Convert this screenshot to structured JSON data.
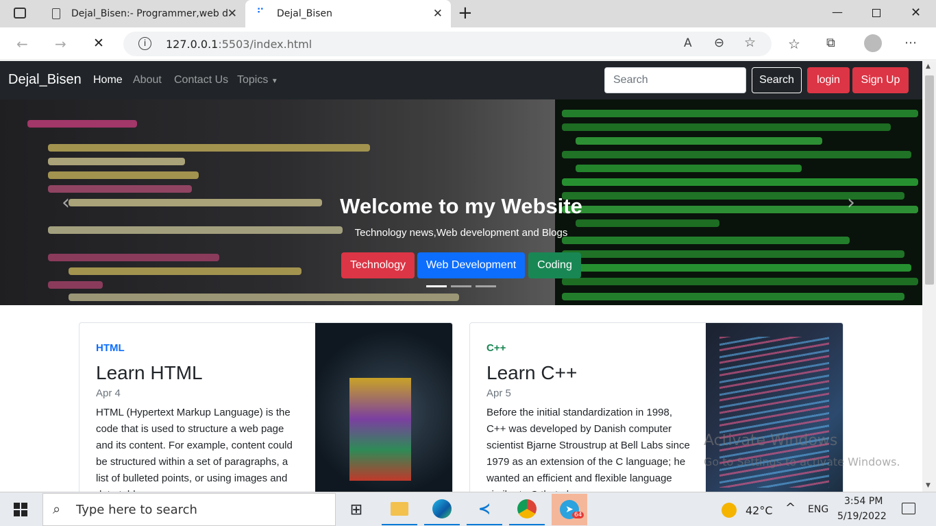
{
  "browser": {
    "tabs": [
      {
        "title": "Dejal_Bisen:- Programmer,web d"
      },
      {
        "title": "Dejal_Bisen"
      }
    ],
    "url_host": "127.0.0.1",
    "url_rest": ":5503/index.html"
  },
  "navbar": {
    "brand": "Dejal_Bisen",
    "links": [
      "Home",
      "About",
      "Contact Us",
      "Topics"
    ],
    "search_placeholder": "Search",
    "search_button": "Search",
    "login": "login",
    "signup": "Sign Up"
  },
  "hero": {
    "title": "Welcome to my Website",
    "subtitle": "Technology news,Web development and Blogs",
    "buttons": [
      "Technology",
      "Web Development",
      "Coding"
    ]
  },
  "cards": [
    {
      "category": "HTML",
      "title": "Learn HTML",
      "date": "Apr 4",
      "text": "HTML (Hypertext Markup Language) is the code that is used to structure a web page and its content. For example, content could be structured within a set of paragraphs, a list of bulleted points, or using images and data tables."
    },
    {
      "category": "C++",
      "title": "Learn C++",
      "date": "Apr 5",
      "text": "Before the initial standardization in 1998, C++ was developed by Danish computer scientist Bjarne Stroustrup at Bell Labs since 1979 as an extension of the C language; he wanted an efficient and flexible language similar to C that also"
    }
  ],
  "watermark": {
    "line1": "Activate Windows",
    "line2": "Go to Settings to activate Windows."
  },
  "taskbar": {
    "search_placeholder": "Type here to search",
    "temperature": "42°C",
    "language": "ENG",
    "time": "3:54 PM",
    "date": "5/19/2022",
    "telegram_badge": "64"
  },
  "colors": {
    "navbar": "#212529",
    "danger": "#dc3545",
    "primary": "#0d6efd",
    "success": "#198754"
  }
}
